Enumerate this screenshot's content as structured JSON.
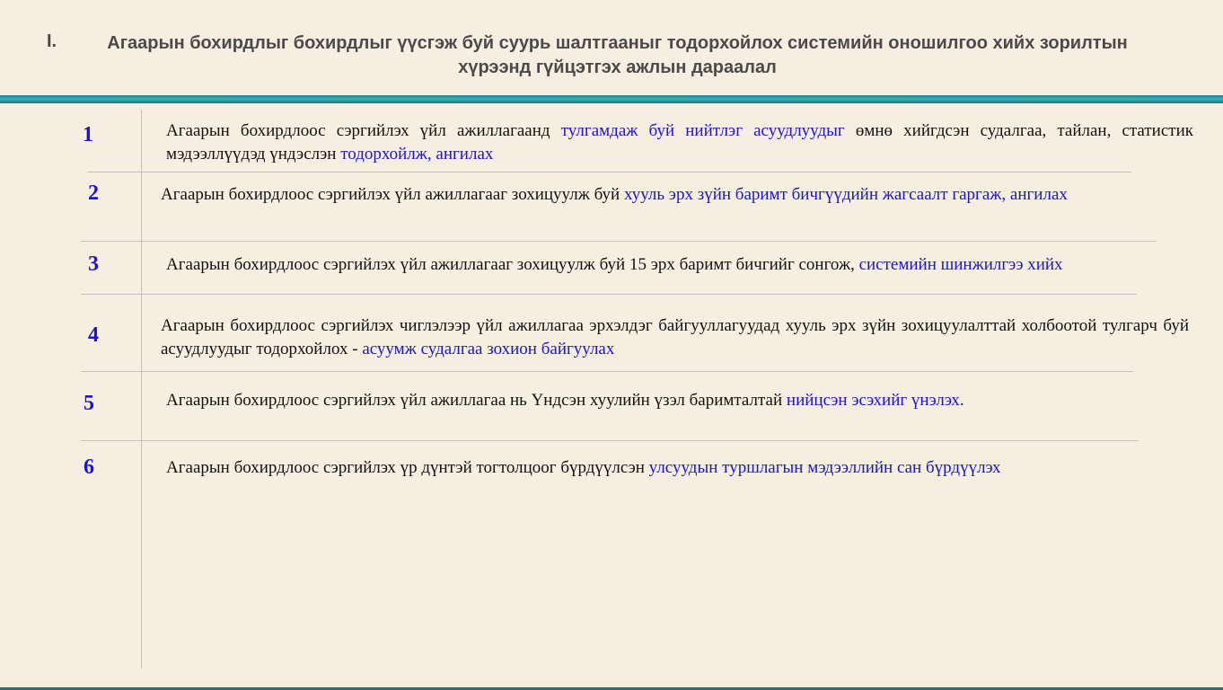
{
  "title": {
    "roman": "I.",
    "text": "Агаарын бохирдлыг бохирдлыг үүсгэж буй суурь шалтгааныг тодорхойлох системийн оношилгоо хийх зорилтын хүрээнд гүйцэтгэх ажлын дараалал"
  },
  "colors": {
    "background": "#f6efe1",
    "accent_band": "#2a9aa3",
    "highlight": "#1a14d9",
    "title": "#4a4a4a"
  },
  "steps": [
    {
      "num": "1",
      "text": "Агаарын бохирдлоос сэргийлэх үйл ажиллагаанд ",
      "hl1": "тулгамдаж буй нийтлэг асуудлуудыг",
      "text2": " өмнө хийгдсэн судалгаа, тайлан, статистик мэдээллүүдэд үндэслэн ",
      "hl2": "тодорхойлж, ангилах"
    },
    {
      "num": "2",
      "text": "Агаарын бохирдлоос сэргийлэх үйл ажиллагааг зохицуулж буй ",
      "hl1": "хууль эрх зүйн баримт бичгүүдийн жагсаалт гаргаж, ангилах",
      "text2": "",
      "hl2": ""
    },
    {
      "num": "3",
      "text": "Агаарын бохирдлоос сэргийлэх үйл ажиллагааг зохицуулж буй 15 эрх баримт бичгийг сонгож, ",
      "hl1": "системийн шинжилгээ хийх",
      "text2": "",
      "hl2": ""
    },
    {
      "num": "4",
      "text": "Агаарын бохирдлоос сэргийлэх чиглэлээр үйл ажиллагаа эрхэлдэг байгууллагуудад хууль эрх зүйн зохицуулалттай холбоотой тулгарч буй асуудлуудыг тодорхойлох - ",
      "hl1": "асуумж судалгаа зохион байгуулах",
      "text2": "",
      "hl2": ""
    },
    {
      "num": "5",
      "text": "Агаарын бохирдлоос сэргийлэх үйл ажиллагаа нь Үндсэн хуулийн үзэл баримталтай ",
      "hl1": "нийцсэн эсэхийг үнэлэх",
      "text2": ".",
      "hl2": ""
    },
    {
      "num": "6",
      "text": "Агаарын бохирдлоос сэргийлэх үр дүнтэй тогтолцоог бүрдүүлсэн ",
      "hl1": "улсуудын туршлагын мэдээллийн сан бүрдүүлэх",
      "text2": "",
      "hl2": ""
    }
  ]
}
